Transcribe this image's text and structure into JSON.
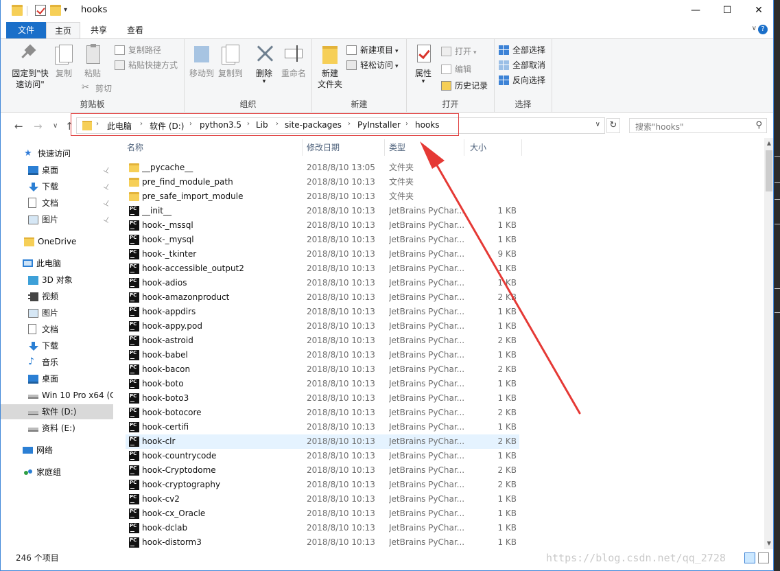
{
  "window": {
    "title": "hooks",
    "minimize_glyph": "—",
    "maximize_glyph": "☐",
    "close_glyph": "✕",
    "qa_dropdown_glyph": "▾"
  },
  "ribbon": {
    "tabs": [
      "文件",
      "主页",
      "共享",
      "查看"
    ],
    "active_tab": "主页",
    "collapse_glyph": "∨",
    "help_glyph": "?",
    "clipboard": {
      "label": "剪贴板",
      "pin": "固定到\"快",
      "pin2": "速访问\"",
      "copy": "复制",
      "paste": "粘贴",
      "copy_path": "复制路径",
      "paste_shortcut": "粘贴快捷方式",
      "cut": "剪切"
    },
    "organize": {
      "label": "组织",
      "move_to": "移动到",
      "copy_to": "复制到",
      "delete": "删除",
      "rename": "重命名"
    },
    "new": {
      "label": "新建",
      "new_folder": "新建",
      "new_folder2": "文件夹",
      "new_item": "新建项目",
      "easy_access": "轻松访问"
    },
    "open": {
      "label": "打开",
      "properties": "属性",
      "open": "打开",
      "edit": "编辑",
      "history": "历史记录"
    },
    "select": {
      "label": "选择",
      "select_all": "全部选择",
      "select_none": "全部取消",
      "invert": "反向选择"
    }
  },
  "nav": {
    "back_glyph": "←",
    "forward_glyph": "→",
    "recent_glyph": "∨",
    "up_glyph": "↑",
    "breadcrumbs": [
      "此电脑",
      "软件 (D:)",
      "python3.5",
      "Lib",
      "site-packages",
      "PyInstaller",
      "hooks"
    ],
    "crumb_sep": "›",
    "address_dropdown": "∨",
    "refresh_glyph": "↻",
    "search_placeholder": "搜索\"hooks\"",
    "search_glyph": "⚲"
  },
  "sidebar": {
    "items": [
      {
        "label": "快速访问",
        "icon": "star-icon"
      },
      {
        "label": "桌面",
        "icon": "desktop-icon",
        "pinned": true
      },
      {
        "label": "下载",
        "icon": "download-icon",
        "pinned": true
      },
      {
        "label": "文档",
        "icon": "document-icon",
        "pinned": true
      },
      {
        "label": "图片",
        "icon": "picture-icon",
        "pinned": true
      },
      {
        "label": "OneDrive",
        "icon": "onedrive-icon"
      },
      {
        "label": "此电脑",
        "icon": "computer-icon"
      },
      {
        "label": "3D 对象",
        "icon": "3d-objects-icon"
      },
      {
        "label": "视频",
        "icon": "video-icon"
      },
      {
        "label": "图片",
        "icon": "picture-icon"
      },
      {
        "label": "文档",
        "icon": "document-icon"
      },
      {
        "label": "下载",
        "icon": "download-icon"
      },
      {
        "label": "音乐",
        "icon": "music-icon"
      },
      {
        "label": "桌面",
        "icon": "desktop-icon"
      },
      {
        "label": "Win 10 Pro x64 (C",
        "icon": "windows-drive-icon"
      },
      {
        "label": "软件 (D:)",
        "icon": "drive-icon",
        "selected": true
      },
      {
        "label": "资料 (E:)",
        "icon": "drive-icon"
      },
      {
        "label": "网络",
        "icon": "network-icon"
      },
      {
        "label": "家庭组",
        "icon": "homegroup-icon"
      }
    ],
    "pin_glyph": "📌"
  },
  "filelist": {
    "columns": [
      "名称",
      "修改日期",
      "类型",
      "大小"
    ],
    "sort_glyph": "⌃",
    "rows": [
      {
        "name": "__pycache__",
        "date": "2018/8/10 13:05",
        "type": "文件夹",
        "size": "",
        "kind": "folder"
      },
      {
        "name": "pre_find_module_path",
        "date": "2018/8/10 10:13",
        "type": "文件夹",
        "size": "",
        "kind": "folder"
      },
      {
        "name": "pre_safe_import_module",
        "date": "2018/8/10 10:13",
        "type": "文件夹",
        "size": "",
        "kind": "folder"
      },
      {
        "name": "__init__",
        "date": "2018/8/10 10:13",
        "type": "JetBrains PyChar...",
        "size": "1 KB",
        "kind": "py"
      },
      {
        "name": "hook-_mssql",
        "date": "2018/8/10 10:13",
        "type": "JetBrains PyChar...",
        "size": "1 KB",
        "kind": "py"
      },
      {
        "name": "hook-_mysql",
        "date": "2018/8/10 10:13",
        "type": "JetBrains PyChar...",
        "size": "1 KB",
        "kind": "py"
      },
      {
        "name": "hook-_tkinter",
        "date": "2018/8/10 10:13",
        "type": "JetBrains PyChar...",
        "size": "9 KB",
        "kind": "py"
      },
      {
        "name": "hook-accessible_output2",
        "date": "2018/8/10 10:13",
        "type": "JetBrains PyChar...",
        "size": "1 KB",
        "kind": "py"
      },
      {
        "name": "hook-adios",
        "date": "2018/8/10 10:13",
        "type": "JetBrains PyChar...",
        "size": "1 KB",
        "kind": "py"
      },
      {
        "name": "hook-amazonproduct",
        "date": "2018/8/10 10:13",
        "type": "JetBrains PyChar...",
        "size": "2 KB",
        "kind": "py"
      },
      {
        "name": "hook-appdirs",
        "date": "2018/8/10 10:13",
        "type": "JetBrains PyChar...",
        "size": "1 KB",
        "kind": "py"
      },
      {
        "name": "hook-appy.pod",
        "date": "2018/8/10 10:13",
        "type": "JetBrains PyChar...",
        "size": "1 KB",
        "kind": "py"
      },
      {
        "name": "hook-astroid",
        "date": "2018/8/10 10:13",
        "type": "JetBrains PyChar...",
        "size": "2 KB",
        "kind": "py"
      },
      {
        "name": "hook-babel",
        "date": "2018/8/10 10:13",
        "type": "JetBrains PyChar...",
        "size": "1 KB",
        "kind": "py"
      },
      {
        "name": "hook-bacon",
        "date": "2018/8/10 10:13",
        "type": "JetBrains PyChar...",
        "size": "2 KB",
        "kind": "py"
      },
      {
        "name": "hook-boto",
        "date": "2018/8/10 10:13",
        "type": "JetBrains PyChar...",
        "size": "1 KB",
        "kind": "py"
      },
      {
        "name": "hook-boto3",
        "date": "2018/8/10 10:13",
        "type": "JetBrains PyChar...",
        "size": "1 KB",
        "kind": "py"
      },
      {
        "name": "hook-botocore",
        "date": "2018/8/10 10:13",
        "type": "JetBrains PyChar...",
        "size": "2 KB",
        "kind": "py"
      },
      {
        "name": "hook-certifi",
        "date": "2018/8/10 10:13",
        "type": "JetBrains PyChar...",
        "size": "1 KB",
        "kind": "py"
      },
      {
        "name": "hook-clr",
        "date": "2018/8/10 10:13",
        "type": "JetBrains PyChar...",
        "size": "2 KB",
        "kind": "py",
        "highlight": true
      },
      {
        "name": "hook-countrycode",
        "date": "2018/8/10 10:13",
        "type": "JetBrains PyChar...",
        "size": "1 KB",
        "kind": "py"
      },
      {
        "name": "hook-Cryptodome",
        "date": "2018/8/10 10:13",
        "type": "JetBrains PyChar...",
        "size": "2 KB",
        "kind": "py"
      },
      {
        "name": "hook-cryptography",
        "date": "2018/8/10 10:13",
        "type": "JetBrains PyChar...",
        "size": "2 KB",
        "kind": "py"
      },
      {
        "name": "hook-cv2",
        "date": "2018/8/10 10:13",
        "type": "JetBrains PyChar...",
        "size": "1 KB",
        "kind": "py"
      },
      {
        "name": "hook-cx_Oracle",
        "date": "2018/8/10 10:13",
        "type": "JetBrains PyChar...",
        "size": "1 KB",
        "kind": "py"
      },
      {
        "name": "hook-dclab",
        "date": "2018/8/10 10:13",
        "type": "JetBrains PyChar...",
        "size": "1 KB",
        "kind": "py"
      },
      {
        "name": "hook-distorm3",
        "date": "2018/8/10 10:13",
        "type": "JetBrains PyChar...",
        "size": "1 KB",
        "kind": "py"
      }
    ]
  },
  "status": {
    "item_count": "246 个项目"
  },
  "watermark": "https://blog.csdn.net/qq_2728",
  "colors": {
    "accent": "#1a6fc9",
    "annotation": "#e53935",
    "hover_row": "#e5f3ff",
    "selected_nav": "#d9d9d9"
  }
}
